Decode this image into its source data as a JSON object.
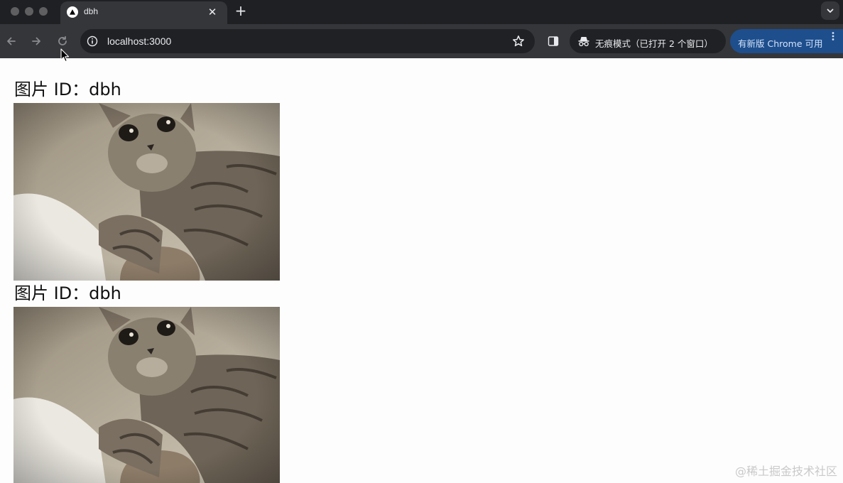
{
  "browser": {
    "tab": {
      "title": "dbh",
      "favicon": "nextjs-triangle-icon"
    },
    "omnibox": {
      "url": "localhost:3000"
    },
    "incognito": {
      "label": "无痕模式（已打开 2 个窗口）"
    },
    "update": {
      "label": "有新版 Chrome 可用"
    }
  },
  "page": {
    "images": [
      {
        "label": "图片 ID：dbh",
        "image": "kitten-photo"
      },
      {
        "label": "图片 ID：dbh",
        "image": "kitten-photo"
      }
    ],
    "watermark": "@稀土掘金技术社区"
  },
  "colors": {
    "tabstrip_bg": "#1f2023",
    "toolbar_bg": "#35363a",
    "omnibox_bg": "#202124",
    "update_chip_bg": "#1e4e8c"
  }
}
